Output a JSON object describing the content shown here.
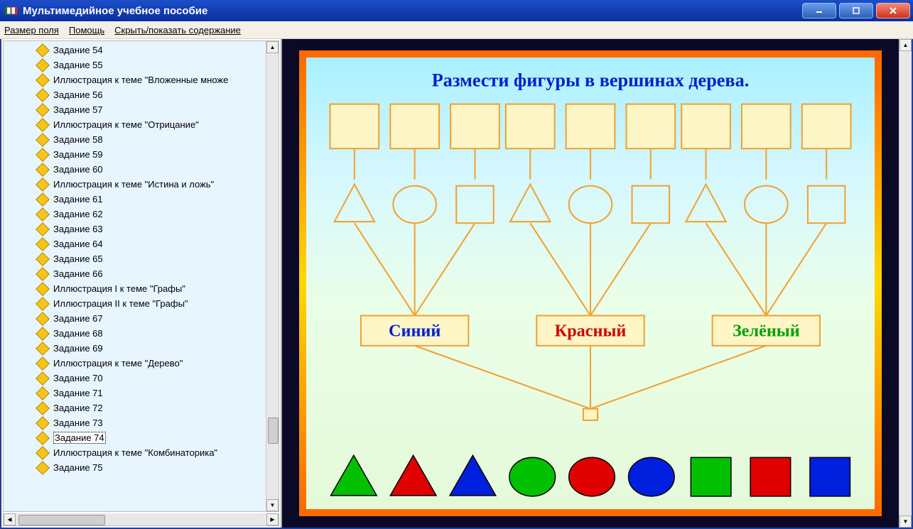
{
  "window": {
    "title": "Мультимедийное учебное пособие"
  },
  "menu": {
    "field_size": "Размер поля",
    "help": "Помощь",
    "toggle_toc": "Скрыть/показать содержание"
  },
  "tree": {
    "selected_index": 22,
    "items": [
      "Задание 54",
      "Задание 55",
      "Иллюстрация к теме \"Вложенные множе",
      "Задание 56",
      "Задание 57",
      "Иллюстрация к теме \"Отрицание\"",
      "Задание 58",
      "Задание 59",
      "Задание 60",
      "Иллюстрация к теме \"Истина и ложь\"",
      "Задание 61",
      "Задание 62",
      "Задание 63",
      "Задание 64",
      "Задание 65",
      "Задание 66",
      "Иллюстрация I к теме \"Графы\"",
      "Иллюстрация II к теме \"Графы\"",
      "Задание 67",
      "Задание 68",
      "Задание 69",
      "Иллюстрация к теме \"Дерево\"",
      "Задание 70",
      "Задание 71",
      "Задание 72",
      "Задание 73",
      "Задание 74",
      "Иллюстрация к теме \"Комбинаторика\"",
      "Задание 75"
    ]
  },
  "task": {
    "title": "Размести фигуры в вершинах дерева.",
    "groups": [
      "Синий",
      "Красный",
      "Зелёный"
    ],
    "group_colors": [
      "#0020d0",
      "#d00000",
      "#00a000"
    ],
    "palette": [
      {
        "shape": "triangle",
        "color": "#00c000"
      },
      {
        "shape": "triangle",
        "color": "#e00000"
      },
      {
        "shape": "triangle",
        "color": "#0020e0"
      },
      {
        "shape": "circle",
        "color": "#00c000"
      },
      {
        "shape": "circle",
        "color": "#e00000"
      },
      {
        "shape": "circle",
        "color": "#0020e0"
      },
      {
        "shape": "square",
        "color": "#00c000"
      },
      {
        "shape": "square",
        "color": "#e00000"
      },
      {
        "shape": "square",
        "color": "#0020e0"
      }
    ]
  }
}
